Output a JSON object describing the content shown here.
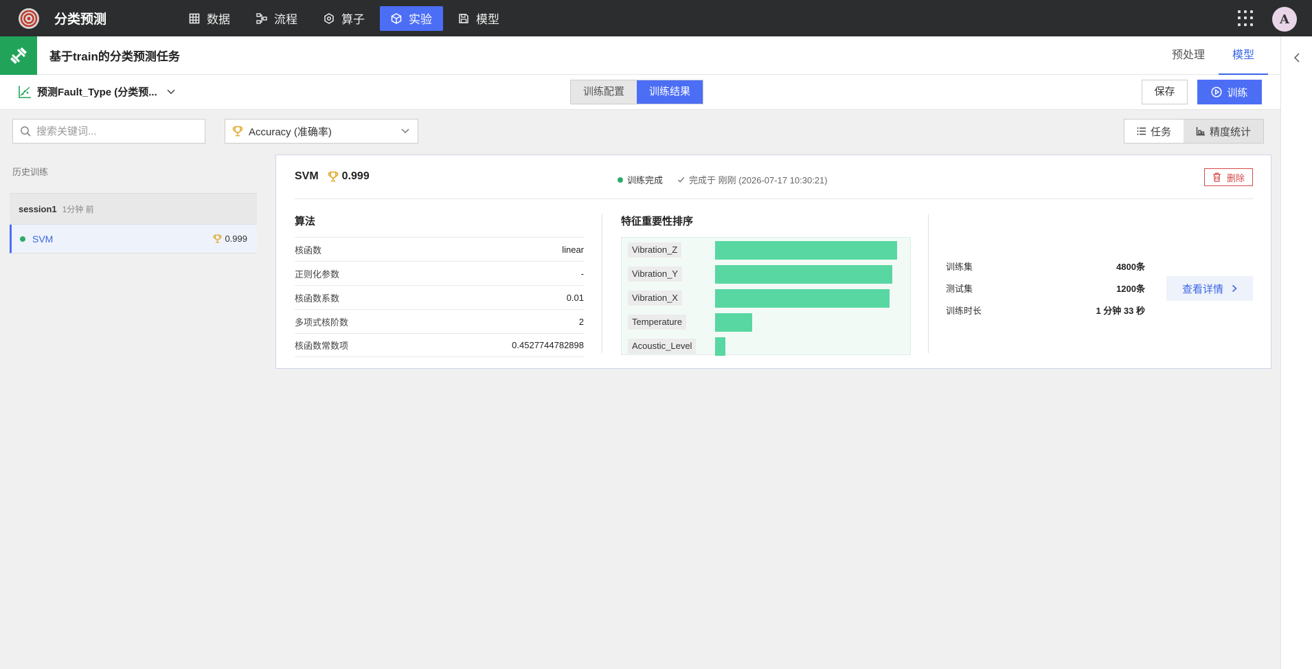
{
  "app": {
    "title": "分类预测",
    "avatar_letter": "A"
  },
  "nav": [
    {
      "label": "数据",
      "icon": "table-icon"
    },
    {
      "label": "流程",
      "icon": "flow-icon"
    },
    {
      "label": "算子",
      "icon": "hexagon-icon"
    },
    {
      "label": "实验",
      "icon": "cube-icon",
      "active": true
    },
    {
      "label": "模型",
      "icon": "save-icon"
    }
  ],
  "task": {
    "title": "基于train的分类预测任务",
    "tabs": [
      {
        "label": "预处理"
      },
      {
        "label": "模型",
        "active": true
      }
    ]
  },
  "toolbar": {
    "model_select": "预测Fault_Type (分类预...",
    "seg": [
      {
        "label": "训练配置"
      },
      {
        "label": "训练结果",
        "active": true
      }
    ],
    "save_label": "保存",
    "train_label": "训练"
  },
  "filters": {
    "search_placeholder": "搜索关键词...",
    "metric": "Accuracy (准确率)",
    "views": [
      {
        "label": "任务",
        "active": true
      },
      {
        "label": "精度统计"
      }
    ]
  },
  "sidebar": {
    "history_label": "历史训练",
    "session": {
      "name": "session1",
      "time": "1分钟 前"
    },
    "runs": [
      {
        "name": "SVM",
        "score": "0.999"
      }
    ]
  },
  "result": {
    "algo": "SVM",
    "score": "0.999",
    "status": "训练完成",
    "finished": "完成于 刚刚 (2026-07-17 10:30:21)",
    "delete_label": "删除",
    "algo_section": "算法",
    "params": [
      {
        "key": "核函数",
        "value": "linear"
      },
      {
        "key": "正则化参数",
        "value": "-"
      },
      {
        "key": "核函数系数",
        "value": "0.01"
      },
      {
        "key": "多项式核阶数",
        "value": "2"
      },
      {
        "key": "核函数常数项",
        "value": "0.4527744782898"
      }
    ],
    "fi_section": "特征重要性排序",
    "feature_importance": [
      {
        "name": "Vibration_Z",
        "share": 0.98
      },
      {
        "name": "Vibration_Y",
        "share": 0.955
      },
      {
        "name": "Vibration_X",
        "share": 0.94
      },
      {
        "name": "Temperature",
        "share": 0.2
      },
      {
        "name": "Acoustic_Level",
        "share": 0.055
      }
    ],
    "stats": [
      {
        "key": "训练集",
        "value": "4800条"
      },
      {
        "key": "测试集",
        "value": "1200条"
      },
      {
        "key": "训练时长",
        "value": "1 分钟 33 秒"
      }
    ],
    "detail_label": "查看详情"
  },
  "colors": {
    "accent": "#4c6ef5",
    "success": "#2eaa6a",
    "bar": "#58d7a2",
    "danger": "#d54a4a",
    "task_icon_bg": "#21a45a"
  }
}
